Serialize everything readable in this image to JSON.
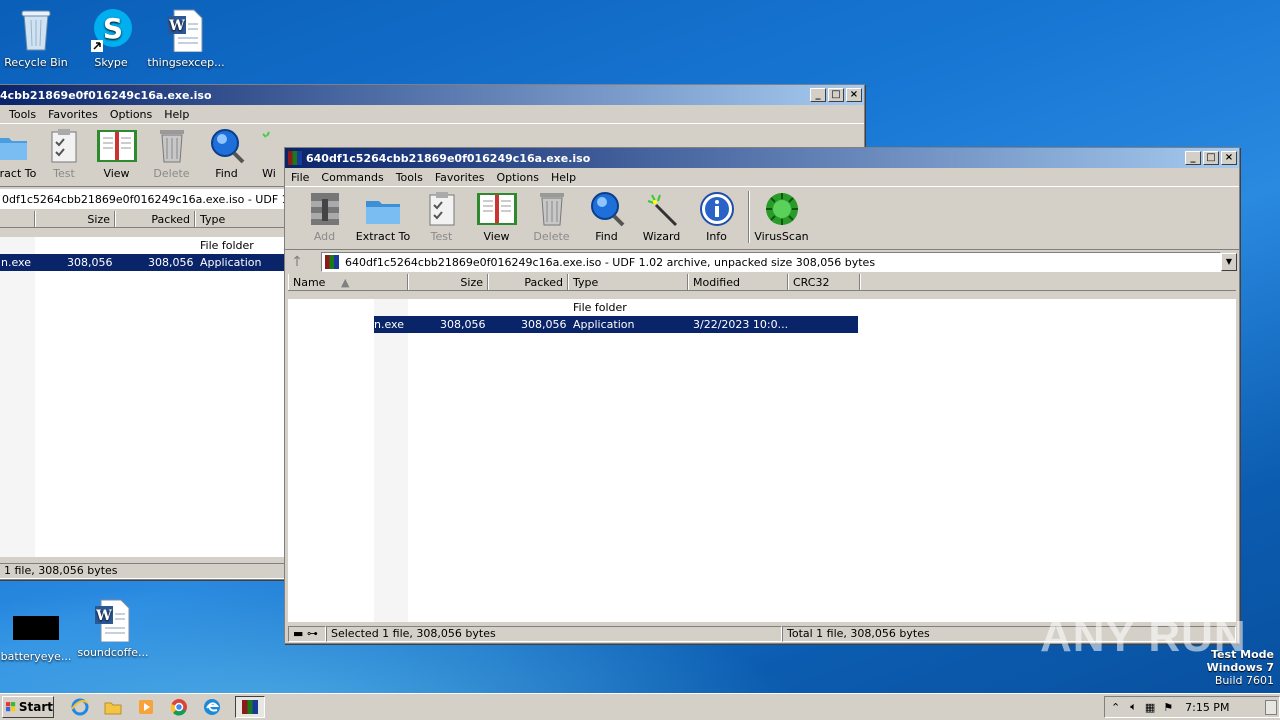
{
  "desktop": {
    "icons_top": [
      {
        "label": "Recycle Bin",
        "icon": "recycle-bin-icon"
      },
      {
        "label": "Skype",
        "icon": "skype-icon"
      },
      {
        "label": "thingsexcep...",
        "icon": "word-document-icon"
      }
    ],
    "icons_bottom": [
      {
        "label": "batteryeye...",
        "icon": "black-thumbnail-icon"
      },
      {
        "label": "soundcoffe...",
        "icon": "word-document-icon"
      }
    ],
    "watermark": "ANY RUN",
    "test_mode": {
      "line1": "Test Mode",
      "line2": "Windows 7",
      "line3": "Build 7601"
    }
  },
  "back_window": {
    "title": "4cbb21869e0f016249c16a.exe.iso",
    "menu": [
      "Tools",
      "Favorites",
      "Options",
      "Help"
    ],
    "tools": [
      {
        "label": "ract To",
        "icon": "extract-to-icon",
        "disabled": false
      },
      {
        "label": "Test",
        "icon": "test-icon",
        "disabled": true
      },
      {
        "label": "View",
        "icon": "view-icon",
        "disabled": false
      },
      {
        "label": "Delete",
        "icon": "delete-icon",
        "disabled": true
      },
      {
        "label": "Find",
        "icon": "find-icon",
        "disabled": false
      },
      {
        "label": "Wi",
        "icon": "wizard-icon",
        "disabled": false
      }
    ],
    "path": "0df1c5264cbb21869e0f016249c16a.exe.iso - UDF 1.02 ar",
    "columns": [
      "Size",
      "Packed",
      "Type"
    ],
    "rows": [
      {
        "name": "",
        "size": "",
        "packed": "",
        "type": "File folder",
        "selected": false
      },
      {
        "name": "n.exe",
        "size": "308,056",
        "packed": "308,056",
        "type": "Application",
        "selected": true
      }
    ],
    "status": "1 file, 308,056 bytes"
  },
  "front_window": {
    "title": "640df1c5264cbb21869e0f016249c16a.exe.iso",
    "menu": [
      "File",
      "Commands",
      "Tools",
      "Favorites",
      "Options",
      "Help"
    ],
    "tools": [
      {
        "label": "Add",
        "icon": "add-archive-icon",
        "disabled": true
      },
      {
        "label": "Extract To",
        "icon": "extract-to-icon",
        "disabled": false
      },
      {
        "label": "Test",
        "icon": "test-icon",
        "disabled": true
      },
      {
        "label": "View",
        "icon": "view-icon",
        "disabled": false
      },
      {
        "label": "Delete",
        "icon": "delete-icon",
        "disabled": true
      },
      {
        "label": "Find",
        "icon": "find-icon",
        "disabled": false
      },
      {
        "label": "Wizard",
        "icon": "wizard-icon",
        "disabled": false
      },
      {
        "label": "Info",
        "icon": "info-icon",
        "disabled": false
      },
      {
        "label": "VirusScan",
        "icon": "virusscan-icon",
        "disabled": false
      }
    ],
    "path": "640df1c5264cbb21869e0f016249c16a.exe.iso - UDF 1.02 archive, unpacked size 308,056 bytes",
    "columns": [
      "Name",
      "Size",
      "Packed",
      "Type",
      "Modified",
      "CRC32"
    ],
    "rows": [
      {
        "name": "",
        "size": "",
        "packed": "",
        "type": "File folder",
        "modified": "",
        "crc": "",
        "selected": false
      },
      {
        "name": "n.exe",
        "size": "308,056",
        "packed": "308,056",
        "type": "Application",
        "modified": "3/22/2023 10:0...",
        "crc": "",
        "selected": true
      }
    ],
    "status_left": "Selected 1 file, 308,056 bytes",
    "status_right": "Total 1 file, 308,056 bytes"
  },
  "taskbar": {
    "start_label": "Start",
    "pinned": [
      "ie-icon",
      "explorer-icon",
      "media-player-icon",
      "chrome-icon",
      "edge-icon",
      "winrar-icon"
    ],
    "clock": "7:15 PM"
  }
}
